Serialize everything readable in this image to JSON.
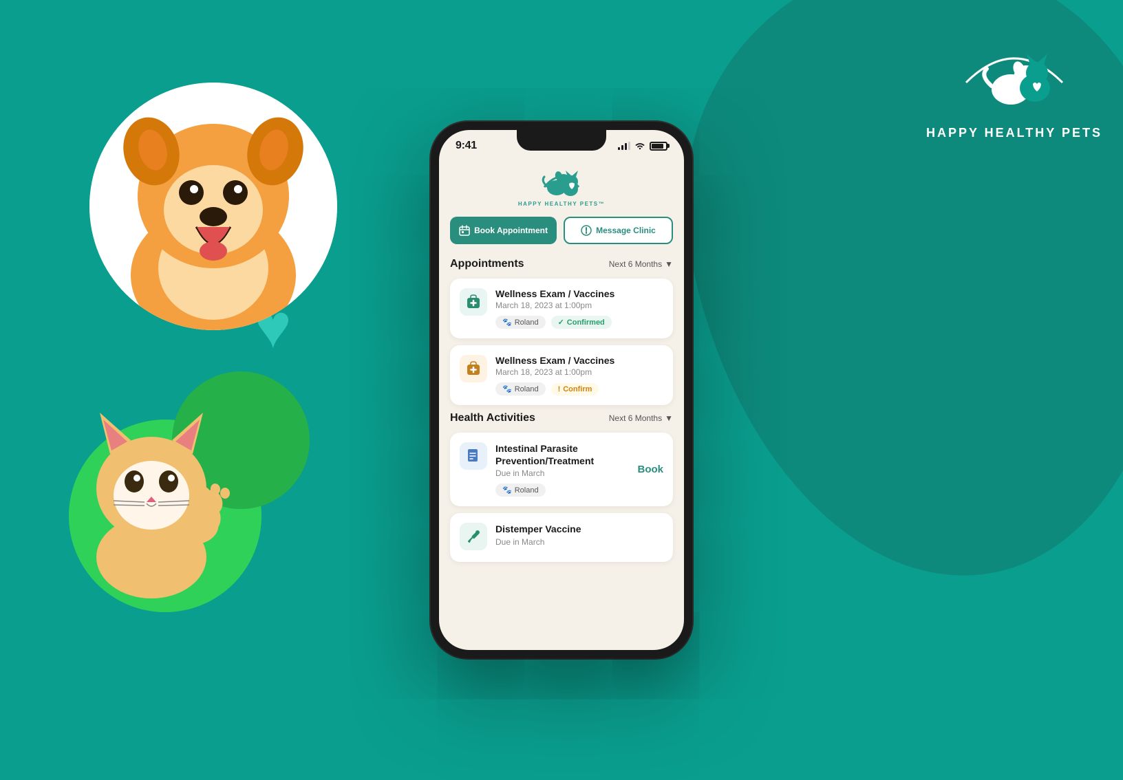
{
  "background": {
    "primary_color": "#0a9e8e",
    "secondary_color": "#0d8a7c"
  },
  "brand": {
    "name": "HAPPY HEALTHY PETS",
    "tagline": "HAPPY HEALTHY PETS™"
  },
  "phone": {
    "status_bar": {
      "time": "9:41",
      "signal": "●●●",
      "wifi": "WiFi",
      "battery": "Battery"
    },
    "logo_text": "HAPPY HEALTHY PETS™",
    "buttons": {
      "book_appointment": "Book Appointment",
      "message_clinic": "Message Clinic"
    },
    "appointments_section": {
      "title": "Appointments",
      "filter": "Next 6 Months",
      "items": [
        {
          "title": "Wellness Exam / Vaccines",
          "datetime": "March 18, 2023 at 1:00pm",
          "pet": "Roland",
          "status": "Confirmed",
          "status_type": "confirmed",
          "icon": "🏥",
          "icon_style": "green"
        },
        {
          "title": "Wellness Exam / Vaccines",
          "datetime": "March 18, 2023 at 1:00pm",
          "pet": "Roland",
          "status": "Confirm",
          "status_type": "pending",
          "icon": "🏥",
          "icon_style": "amber"
        }
      ]
    },
    "health_activities_section": {
      "title": "Health Activities",
      "filter": "Next 6 Months",
      "items": [
        {
          "title": "Intestinal Parasite Prevention/Treatment",
          "due": "Due in March",
          "pet": "Roland",
          "action": "Book",
          "icon": "📋",
          "icon_style": "blue"
        },
        {
          "title": "Distemper Vaccine",
          "due": "Due in March",
          "pet": "",
          "action": "",
          "icon": "💉",
          "icon_style": "green"
        }
      ]
    }
  }
}
